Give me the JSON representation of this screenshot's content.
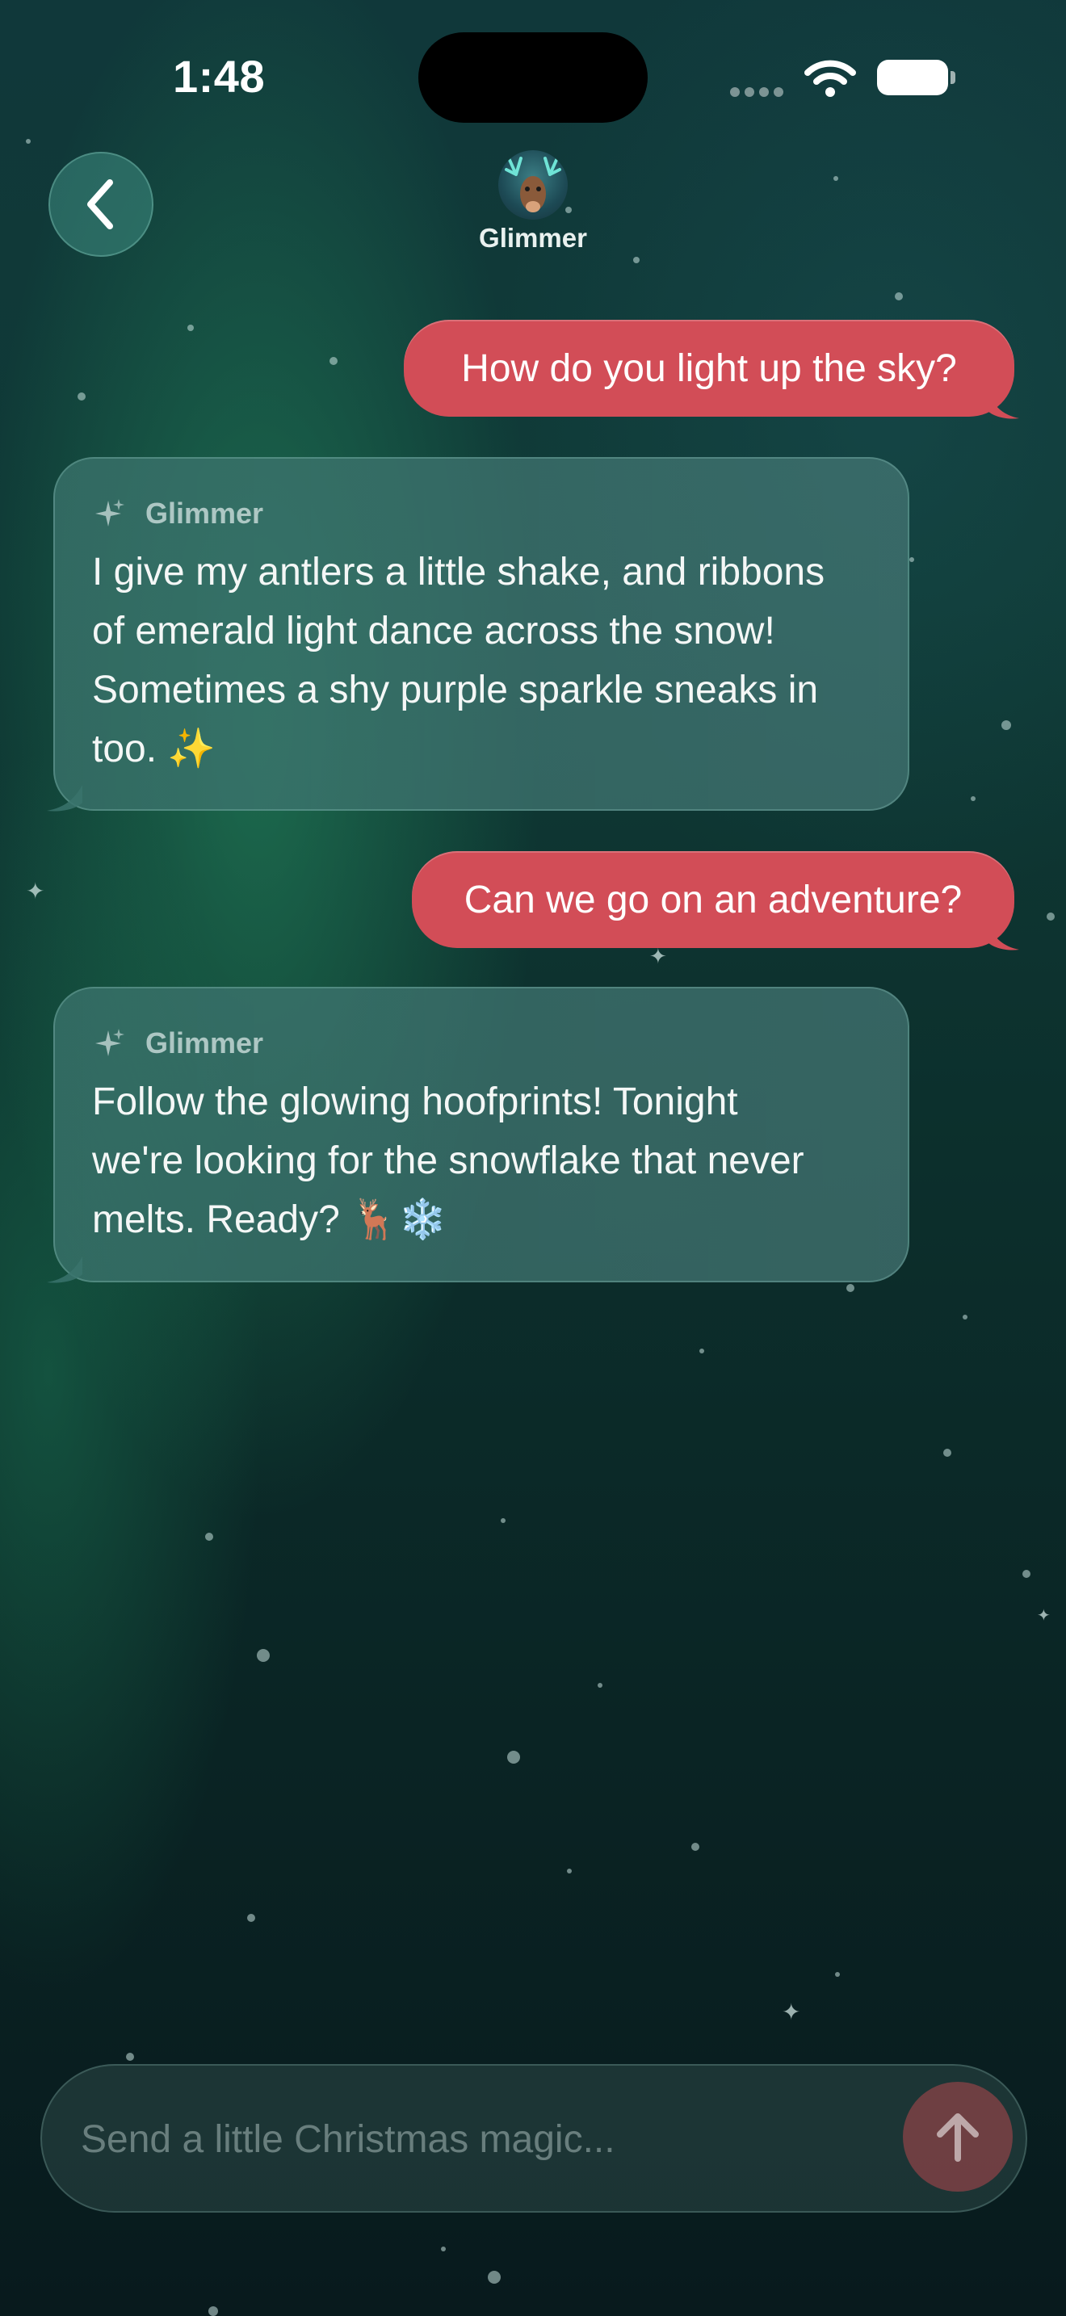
{
  "status_bar": {
    "time": "1:48"
  },
  "header": {
    "back_icon": "chevron-left-icon",
    "contact_name": "Glimmer"
  },
  "messages": [
    {
      "sender": "user",
      "text": "How do you light up the sky?"
    },
    {
      "sender": "bot",
      "name": "Glimmer",
      "icon": "sparkles-icon",
      "text": "I give my antlers a little shake, and ribbons\nof emerald light dance across the snow!\nSometimes a shy purple sparkle sneaks in\ntoo. ✨"
    },
    {
      "sender": "user",
      "text": "Can we go on an adventure?"
    },
    {
      "sender": "bot",
      "name": "Glimmer",
      "icon": "sparkles-icon",
      "text": "Follow the glowing hoofprints! Tonight\nwe're looking for the snowflake that never\nmelts. Ready? 🦌❄️"
    }
  ],
  "composer": {
    "placeholder": "Send a little Christmas magic...",
    "send_icon": "arrow-up-icon"
  },
  "colors": {
    "user_bubble": "#d24d57",
    "bot_bubble": "#3a736c",
    "background": "#0c2f2c",
    "send_button": "#7d4144"
  }
}
